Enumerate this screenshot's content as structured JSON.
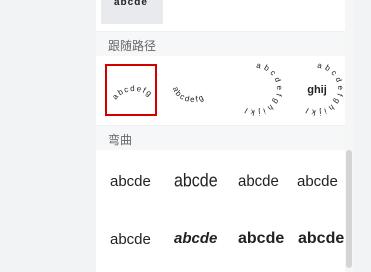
{
  "sections": {
    "follow_path": {
      "title": "跟随路径"
    },
    "warp": {
      "title": "弯曲"
    }
  },
  "previous_tile_text": "abcde",
  "follow_path_presets": [
    {
      "name": "arc-up",
      "text": "abcdefg",
      "selected": true
    },
    {
      "name": "arc-down",
      "text": "abcdefg",
      "selected": false
    },
    {
      "name": "circle",
      "text": "abcdefghijkl",
      "selected": false
    },
    {
      "name": "button",
      "text": "abcdefghijkl",
      "center_text": "ghij",
      "selected": false
    }
  ],
  "warp_presets": [
    {
      "name": "warp-1",
      "text": "abcde"
    },
    {
      "name": "warp-2",
      "text": "abcde"
    },
    {
      "name": "warp-3",
      "text": "abcde"
    },
    {
      "name": "warp-4",
      "text": "abcde"
    },
    {
      "name": "warp-5",
      "text": "abcde"
    },
    {
      "name": "warp-6",
      "text": "abcde"
    },
    {
      "name": "warp-7",
      "text": "abcde"
    },
    {
      "name": "warp-8",
      "text": "abcde"
    }
  ],
  "colors": {
    "selected_border": "#d40000",
    "panel_bg": "#ffffff",
    "header_bg": "#f6f7f9"
  }
}
